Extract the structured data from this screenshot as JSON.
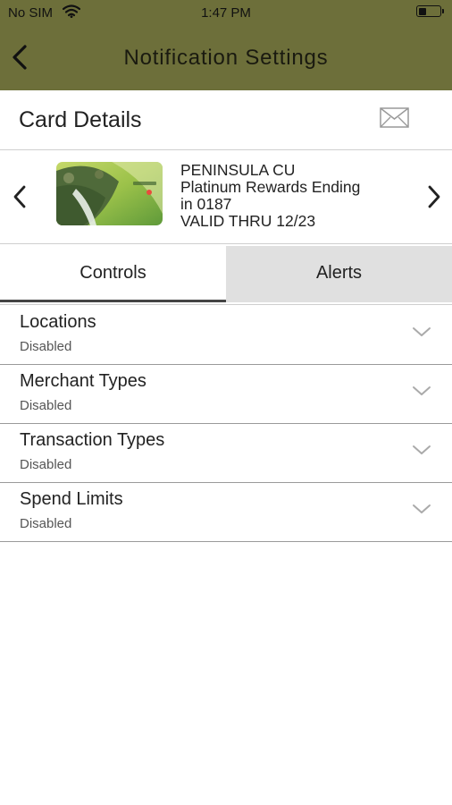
{
  "status_bar": {
    "carrier": "No SIM",
    "time": "1:47 PM"
  },
  "header": {
    "title": "Notification Settings",
    "back_icon": "chevron-left-icon",
    "background": "#6d6f3a"
  },
  "card_details": {
    "title": "Card Details",
    "mail_icon": "envelope-icon",
    "card": {
      "name": "PENINSULA CU",
      "product": "Platinum Rewards Ending",
      "ending": "in 0187",
      "valid": "VALID THRU 12/23"
    }
  },
  "tabs": [
    {
      "label": "Controls",
      "selected": true
    },
    {
      "label": "Alerts",
      "selected": false
    }
  ],
  "controls": [
    {
      "label": "Locations",
      "status": "Disabled"
    },
    {
      "label": "Merchant Types",
      "status": "Disabled"
    },
    {
      "label": "Transaction Types",
      "status": "Disabled"
    },
    {
      "label": "Spend Limits",
      "status": "Disabled"
    }
  ]
}
